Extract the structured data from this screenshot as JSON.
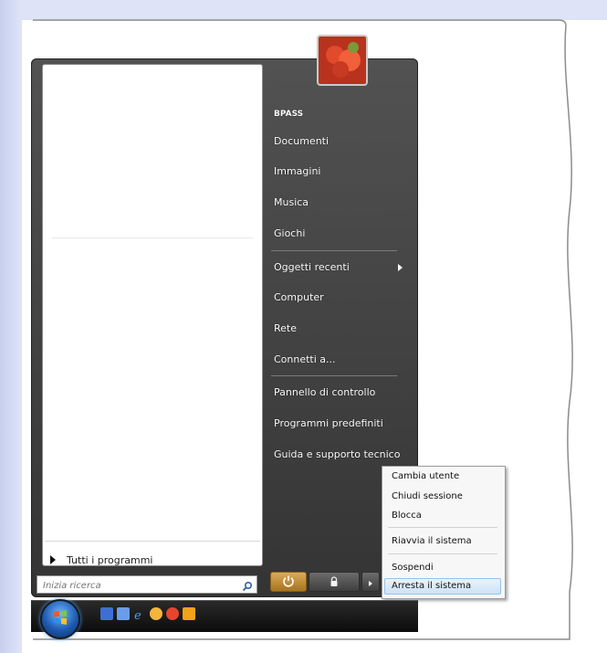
{
  "user": {
    "name": "BPASS"
  },
  "right_menu": {
    "items": [
      {
        "label": "Documenti"
      },
      {
        "label": "Immagini"
      },
      {
        "label": "Musica"
      },
      {
        "label": "Giochi"
      },
      {
        "label": "Oggetti recenti"
      },
      {
        "label": "Computer"
      },
      {
        "label": "Rete"
      },
      {
        "label": "Connetti a..."
      },
      {
        "label": "Pannello di controllo"
      },
      {
        "label": "Programmi predefiniti"
      },
      {
        "label": "Guida e supporto tecnico"
      }
    ]
  },
  "left_pane": {
    "all_programs": "Tutti i programmi"
  },
  "search": {
    "placeholder": "Inizia ricerca"
  },
  "shutdown_menu": {
    "items": [
      {
        "label": "Cambia utente"
      },
      {
        "label": "Chiudi sessione"
      },
      {
        "label": "Blocca"
      },
      {
        "label": "Riavvia il sistema"
      },
      {
        "label": "Sospendi"
      },
      {
        "label": "Arresta il sistema"
      }
    ],
    "highlighted": "Arresta il sistema"
  },
  "icons": {
    "power": "power-icon",
    "lock": "lock-icon",
    "arrow": "chevron-right-icon",
    "search": "search-icon",
    "start": "windows-start-icon"
  },
  "colors": {
    "menu_dark": "#404040",
    "power_button": "#c08a36",
    "highlight": "#cde3f6"
  }
}
